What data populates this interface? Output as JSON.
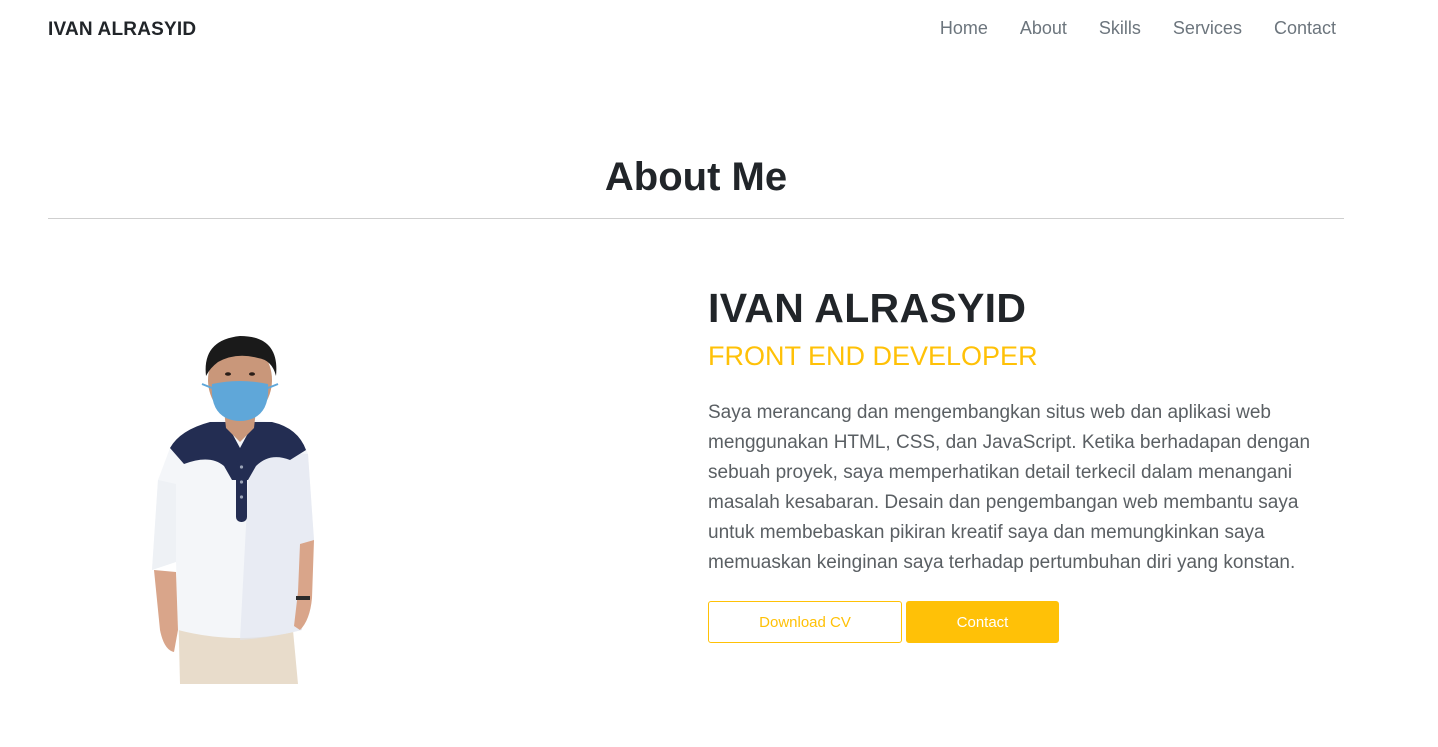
{
  "navbar": {
    "brand": "IVAN ALRASYID",
    "links": [
      "Home",
      "About",
      "Skills",
      "Services",
      "Contact"
    ]
  },
  "about": {
    "title": "About Me",
    "name": "IVAN ALRASYID",
    "role": "FRONT END DEVELOPER",
    "bio": "Saya merancang dan mengembangkan situs web dan aplikasi web menggunakan HTML, CSS, dan JavaScript. Ketika berhadapan dengan sebuah proyek, saya memperhatikan detail terkecil dalam menangani masalah kesabaran. Desain dan pengembangan web membantu saya untuk membebaskan pikiran kreatif saya dan memungkinkan saya memuaskan keinginan saya terhadap pertumbuhan diri yang konstan.",
    "download_cv_label": "Download CV",
    "contact_label": "Contact"
  },
  "colors": {
    "accent": "#ffc107",
    "text": "#212529",
    "muted": "#6c757d"
  }
}
